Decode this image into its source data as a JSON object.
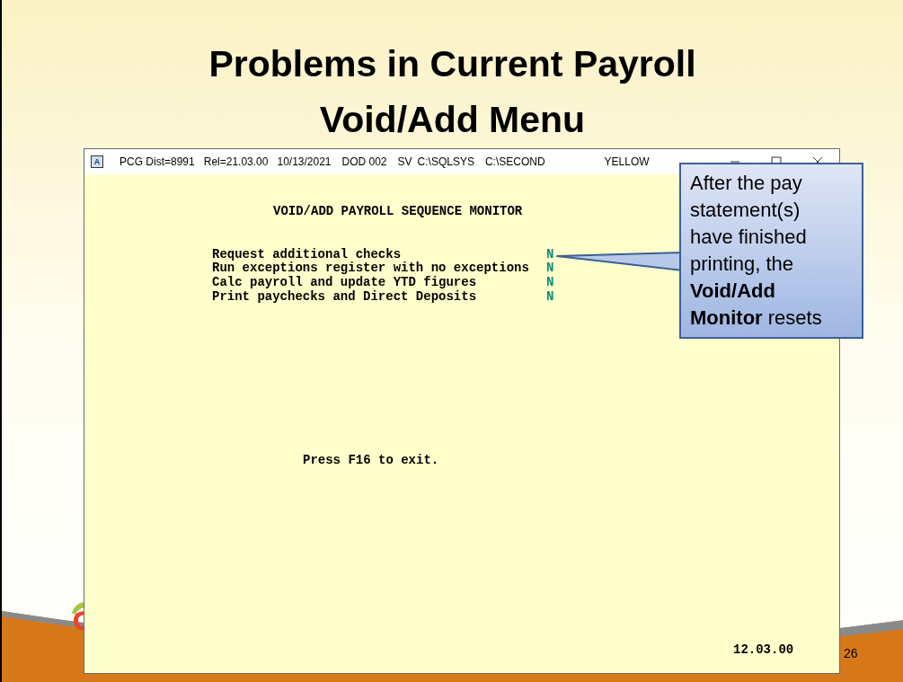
{
  "slide": {
    "title_lines": [
      "Problems in Current Payroll",
      "Void/Add Menu"
    ],
    "page_number": "26"
  },
  "window": {
    "icon_label": "A",
    "title_fields": [
      "PCG Dist=8991",
      "Rel=21.03.00",
      "10/13/2021",
      "DOD 002",
      "SV",
      "C:\\SQLSYS",
      "C:\\SECOND",
      "YELLOW"
    ],
    "heading": "VOID/ADD PAYROLL SEQUENCE MONITOR",
    "items": [
      {
        "label": "Request additional checks",
        "value": "N"
      },
      {
        "label": "Run exceptions register with no exceptions",
        "value": "N"
      },
      {
        "label": "Calc payroll and update YTD figures",
        "value": "N"
      },
      {
        "label": "Print paychecks and Direct Deposits",
        "value": "N"
      }
    ],
    "hint": "Press F16 to exit.",
    "version": "12.03.00"
  },
  "callout": {
    "text": "After the pay statement(s) have finished printing, the **Void/Add Monitor** resets"
  }
}
